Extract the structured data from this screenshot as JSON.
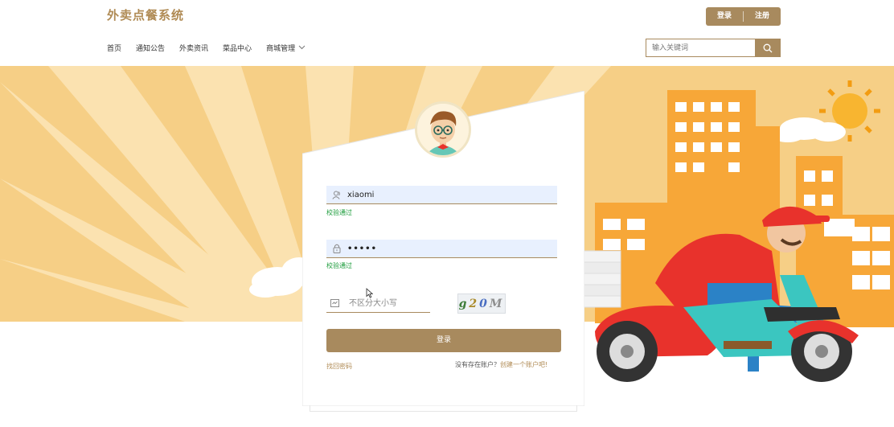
{
  "header": {
    "site_title": "外卖点餐系统",
    "login_label": "登录",
    "register_label": "注册"
  },
  "nav": {
    "items": [
      {
        "label": "首页"
      },
      {
        "label": "通知公告"
      },
      {
        "label": "外卖资讯"
      },
      {
        "label": "菜品中心"
      },
      {
        "label": "商城管理"
      }
    ]
  },
  "search": {
    "placeholder": "输入关键词",
    "icon": "search-icon"
  },
  "login_form": {
    "username": {
      "value": "xiaomi",
      "icon": "user-icon",
      "hint": "校验通过"
    },
    "password": {
      "value": "•••••",
      "icon": "lock-icon",
      "hint": "校验通过"
    },
    "captcha": {
      "placeholder": "不区分大小写",
      "icon": "captcha-icon",
      "image_text": [
        "g",
        "2",
        "0",
        "M"
      ]
    },
    "submit_label": "登录",
    "forgot_label": "找回密码",
    "register_prompt": "没有存在账户？",
    "register_link": "创建一个账户吧!"
  },
  "colors": {
    "accent": "#a88a5e",
    "title": "#b08b55",
    "success": "#1a9b3a",
    "banner": "#f7d38d"
  }
}
